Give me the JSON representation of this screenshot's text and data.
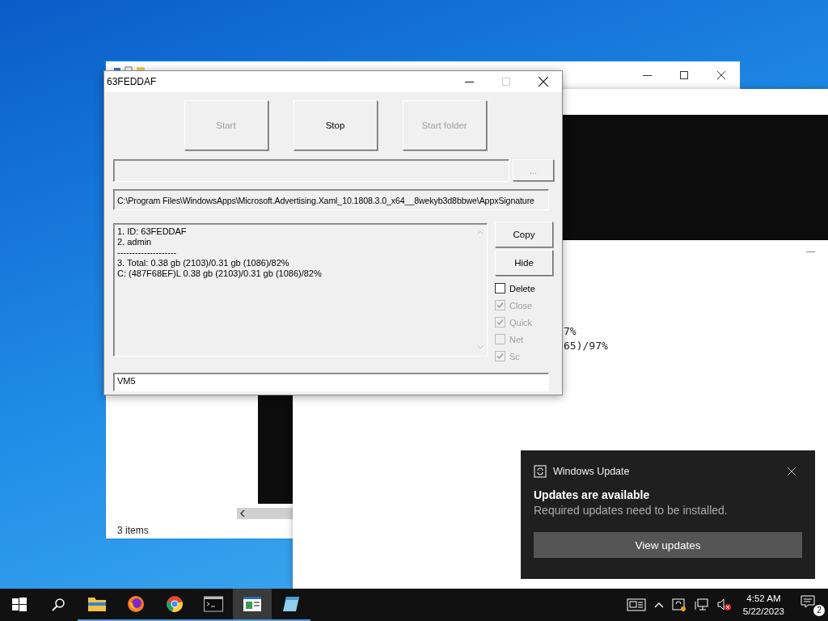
{
  "explorer_window": {
    "status": "3 items"
  },
  "console_window": {
    "lines": [
      "7%",
      "65)/97%"
    ]
  },
  "main_window": {
    "title": "63FEDDAF",
    "buttons": [
      {
        "label": "Start",
        "disabled": true
      },
      {
        "label": "Stop",
        "disabled": false
      },
      {
        "label": "Start folder",
        "disabled": true
      }
    ],
    "browse_button": {
      "label": "...",
      "disabled": true
    },
    "path_field": {
      "value": "C:\\Program Files\\WindowsApps\\Microsoft.Advertising.Xaml_10.1808.3.0_x64__8wekyb3d8bbwe\\AppxSignature"
    },
    "log_lines": [
      "1. ID: 63FEDDAF",
      "2. admin",
      "--------------------",
      "3. Total: 0.38 gb (2103)/0.31 gb (1086)/82%",
      "C: (487F68EF)L 0.38 gb (2103)/0.31 gb (1086)/82%"
    ],
    "side_buttons": [
      "Copy",
      "Hide"
    ],
    "options": [
      {
        "label": "Delete",
        "checked": false,
        "disabled": false
      },
      {
        "label": "Close",
        "checked": true,
        "disabled": true
      },
      {
        "label": "Quick",
        "checked": true,
        "disabled": true
      },
      {
        "label": "Net",
        "checked": false,
        "disabled": true
      },
      {
        "label": "Sc",
        "checked": true,
        "disabled": true
      }
    ],
    "name_field": {
      "value": "VM5"
    }
  },
  "notification": {
    "app": "Windows Update",
    "title": "Updates are available",
    "message": "Required updates need to be installed.",
    "action": "View updates"
  },
  "taskbar": {
    "apps": [
      {
        "kind": "folder",
        "active": false
      },
      {
        "kind": "firefox",
        "active": false
      },
      {
        "kind": "chrome",
        "active": false
      },
      {
        "kind": "terminal",
        "active": false
      },
      {
        "kind": "app",
        "active": true
      },
      {
        "kind": "notepad",
        "active": false
      }
    ],
    "time": "4:52 AM",
    "date": "5/22/2023",
    "notification_count": "2"
  }
}
